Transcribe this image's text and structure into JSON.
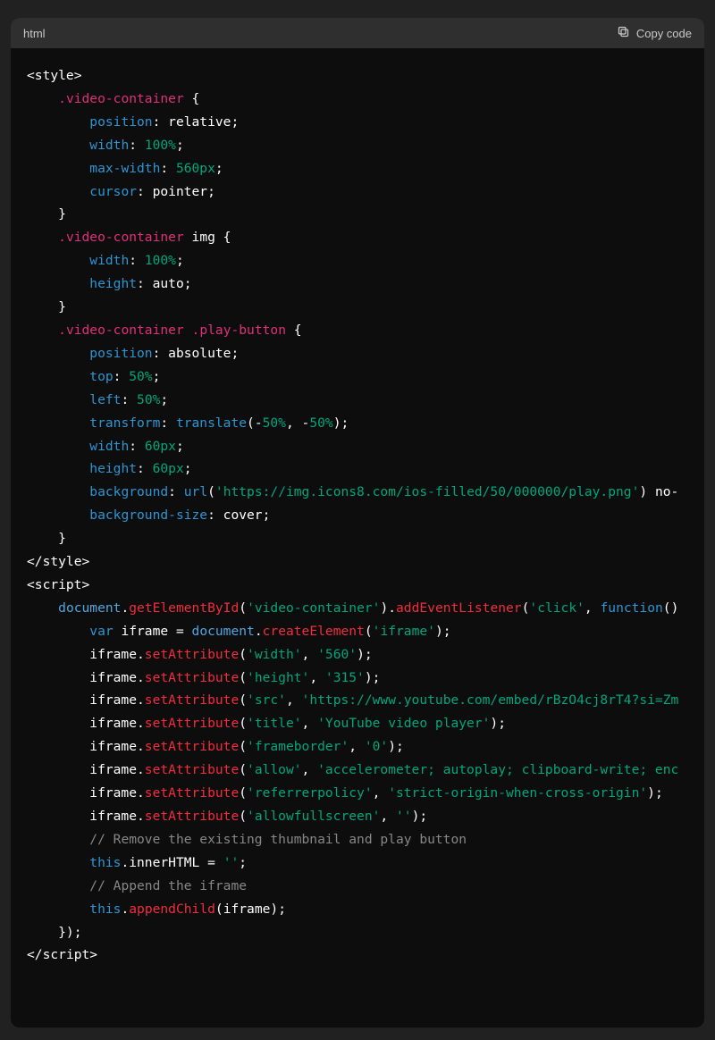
{
  "header": {
    "language": "html",
    "copy_label": "Copy code"
  },
  "code": {
    "lines": [
      [
        [
          "c-white",
          "<style>"
        ]
      ],
      [
        [
          "c-white",
          "    "
        ],
        [
          "c-pink",
          ".video-container"
        ],
        [
          "c-white",
          " {"
        ]
      ],
      [
        [
          "c-white",
          "        "
        ],
        [
          "c-teal",
          "position"
        ],
        [
          "c-white",
          ": relative;"
        ]
      ],
      [
        [
          "c-white",
          "        "
        ],
        [
          "c-teal",
          "width"
        ],
        [
          "c-white",
          ": "
        ],
        [
          "c-green",
          "100%"
        ],
        [
          "c-white",
          ";"
        ]
      ],
      [
        [
          "c-white",
          "        "
        ],
        [
          "c-teal",
          "max-width"
        ],
        [
          "c-white",
          ": "
        ],
        [
          "c-green",
          "560px"
        ],
        [
          "c-white",
          ";"
        ]
      ],
      [
        [
          "c-white",
          "        "
        ],
        [
          "c-teal",
          "cursor"
        ],
        [
          "c-white",
          ": pointer;"
        ]
      ],
      [
        [
          "c-white",
          "    }"
        ]
      ],
      [
        [
          "c-white",
          "    "
        ],
        [
          "c-pink",
          ".video-container"
        ],
        [
          "c-white",
          " img {"
        ]
      ],
      [
        [
          "c-white",
          "        "
        ],
        [
          "c-teal",
          "width"
        ],
        [
          "c-white",
          ": "
        ],
        [
          "c-green",
          "100%"
        ],
        [
          "c-white",
          ";"
        ]
      ],
      [
        [
          "c-white",
          "        "
        ],
        [
          "c-teal",
          "height"
        ],
        [
          "c-white",
          ": auto;"
        ]
      ],
      [
        [
          "c-white",
          "    }"
        ]
      ],
      [
        [
          "c-white",
          "    "
        ],
        [
          "c-pink",
          ".video-container"
        ],
        [
          "c-white",
          " "
        ],
        [
          "c-pink",
          ".play-button"
        ],
        [
          "c-white",
          " {"
        ]
      ],
      [
        [
          "c-white",
          "        "
        ],
        [
          "c-teal",
          "position"
        ],
        [
          "c-white",
          ": absolute;"
        ]
      ],
      [
        [
          "c-white",
          "        "
        ],
        [
          "c-teal",
          "top"
        ],
        [
          "c-white",
          ": "
        ],
        [
          "c-green",
          "50%"
        ],
        [
          "c-white",
          ";"
        ]
      ],
      [
        [
          "c-white",
          "        "
        ],
        [
          "c-teal",
          "left"
        ],
        [
          "c-white",
          ": "
        ],
        [
          "c-green",
          "50%"
        ],
        [
          "c-white",
          ";"
        ]
      ],
      [
        [
          "c-white",
          "        "
        ],
        [
          "c-teal",
          "transform"
        ],
        [
          "c-white",
          ": "
        ],
        [
          "c-teal",
          "translate"
        ],
        [
          "c-white",
          "(-"
        ],
        [
          "c-green",
          "50%"
        ],
        [
          "c-white",
          ", -"
        ],
        [
          "c-green",
          "50%"
        ],
        [
          "c-white",
          ");"
        ]
      ],
      [
        [
          "c-white",
          "        "
        ],
        [
          "c-teal",
          "width"
        ],
        [
          "c-white",
          ": "
        ],
        [
          "c-green",
          "60px"
        ],
        [
          "c-white",
          ";"
        ]
      ],
      [
        [
          "c-white",
          "        "
        ],
        [
          "c-teal",
          "height"
        ],
        [
          "c-white",
          ": "
        ],
        [
          "c-green",
          "60px"
        ],
        [
          "c-white",
          ";"
        ]
      ],
      [
        [
          "c-white",
          "        "
        ],
        [
          "c-teal",
          "background"
        ],
        [
          "c-white",
          ": "
        ],
        [
          "c-teal",
          "url"
        ],
        [
          "c-white",
          "("
        ],
        [
          "c-green",
          "'https://img.icons8.com/ios-filled/50/000000/play.png'"
        ],
        [
          "c-white",
          ") no-"
        ]
      ],
      [
        [
          "c-white",
          "        "
        ],
        [
          "c-teal",
          "background-size"
        ],
        [
          "c-white",
          ": cover;"
        ]
      ],
      [
        [
          "c-white",
          "    }"
        ]
      ],
      [
        [
          "c-white",
          "</style>"
        ]
      ],
      [
        [
          "c-white",
          ""
        ]
      ],
      [
        [
          "c-white",
          "<script>"
        ]
      ],
      [
        [
          "c-white",
          "    "
        ],
        [
          "c-lblue",
          "document"
        ],
        [
          "c-white",
          "."
        ],
        [
          "c-func",
          "getElementById"
        ],
        [
          "c-white",
          "("
        ],
        [
          "c-green",
          "'video-container'"
        ],
        [
          "c-white",
          ")."
        ],
        [
          "c-func",
          "addEventListener"
        ],
        [
          "c-white",
          "("
        ],
        [
          "c-green",
          "'click'"
        ],
        [
          "c-white",
          ", "
        ],
        [
          "c-teal",
          "function"
        ],
        [
          "c-white",
          "()"
        ]
      ],
      [
        [
          "c-white",
          "        "
        ],
        [
          "c-teal",
          "var"
        ],
        [
          "c-white",
          " iframe = "
        ],
        [
          "c-lblue",
          "document"
        ],
        [
          "c-white",
          "."
        ],
        [
          "c-func",
          "createElement"
        ],
        [
          "c-white",
          "("
        ],
        [
          "c-green",
          "'iframe'"
        ],
        [
          "c-white",
          ");"
        ]
      ],
      [
        [
          "c-white",
          "        iframe."
        ],
        [
          "c-func",
          "setAttribute"
        ],
        [
          "c-white",
          "("
        ],
        [
          "c-green",
          "'width'"
        ],
        [
          "c-white",
          ", "
        ],
        [
          "c-green",
          "'560'"
        ],
        [
          "c-white",
          ");"
        ]
      ],
      [
        [
          "c-white",
          "        iframe."
        ],
        [
          "c-func",
          "setAttribute"
        ],
        [
          "c-white",
          "("
        ],
        [
          "c-green",
          "'height'"
        ],
        [
          "c-white",
          ", "
        ],
        [
          "c-green",
          "'315'"
        ],
        [
          "c-white",
          ");"
        ]
      ],
      [
        [
          "c-white",
          "        iframe."
        ],
        [
          "c-func",
          "setAttribute"
        ],
        [
          "c-white",
          "("
        ],
        [
          "c-green",
          "'src'"
        ],
        [
          "c-white",
          ", "
        ],
        [
          "c-green",
          "'https://www.youtube.com/embed/rBzO4cj8rT4?si=Zm"
        ]
      ],
      [
        [
          "c-white",
          "        iframe."
        ],
        [
          "c-func",
          "setAttribute"
        ],
        [
          "c-white",
          "("
        ],
        [
          "c-green",
          "'title'"
        ],
        [
          "c-white",
          ", "
        ],
        [
          "c-green",
          "'YouTube video player'"
        ],
        [
          "c-white",
          ");"
        ]
      ],
      [
        [
          "c-white",
          "        iframe."
        ],
        [
          "c-func",
          "setAttribute"
        ],
        [
          "c-white",
          "("
        ],
        [
          "c-green",
          "'frameborder'"
        ],
        [
          "c-white",
          ", "
        ],
        [
          "c-green",
          "'0'"
        ],
        [
          "c-white",
          ");"
        ]
      ],
      [
        [
          "c-white",
          "        iframe."
        ],
        [
          "c-func",
          "setAttribute"
        ],
        [
          "c-white",
          "("
        ],
        [
          "c-green",
          "'allow'"
        ],
        [
          "c-white",
          ", "
        ],
        [
          "c-green",
          "'accelerometer; autoplay; clipboard-write; enc"
        ]
      ],
      [
        [
          "c-white",
          "        iframe."
        ],
        [
          "c-func",
          "setAttribute"
        ],
        [
          "c-white",
          "("
        ],
        [
          "c-green",
          "'referrerpolicy'"
        ],
        [
          "c-white",
          ", "
        ],
        [
          "c-green",
          "'strict-origin-when-cross-origin'"
        ],
        [
          "c-white",
          ");"
        ]
      ],
      [
        [
          "c-white",
          "        iframe."
        ],
        [
          "c-func",
          "setAttribute"
        ],
        [
          "c-white",
          "("
        ],
        [
          "c-green",
          "'allowfullscreen'"
        ],
        [
          "c-white",
          ", "
        ],
        [
          "c-green",
          "''"
        ],
        [
          "c-white",
          ");"
        ]
      ],
      [
        [
          "c-white",
          ""
        ]
      ],
      [
        [
          "c-white",
          "        "
        ],
        [
          "c-grey",
          "// Remove the existing thumbnail and play button"
        ]
      ],
      [
        [
          "c-white",
          "        "
        ],
        [
          "c-teal",
          "this"
        ],
        [
          "c-white",
          ".innerHTML = "
        ],
        [
          "c-green",
          "''"
        ],
        [
          "c-white",
          ";"
        ]
      ],
      [
        [
          "c-white",
          "        "
        ],
        [
          "c-grey",
          "// Append the iframe"
        ]
      ],
      [
        [
          "c-white",
          "        "
        ],
        [
          "c-teal",
          "this"
        ],
        [
          "c-white",
          "."
        ],
        [
          "c-func",
          "appendChild"
        ],
        [
          "c-white",
          "(iframe);"
        ]
      ],
      [
        [
          "c-white",
          "    });"
        ]
      ],
      [
        [
          "c-white",
          "</scr"
        ],
        [
          "c-white",
          "ipt>"
        ]
      ]
    ]
  }
}
